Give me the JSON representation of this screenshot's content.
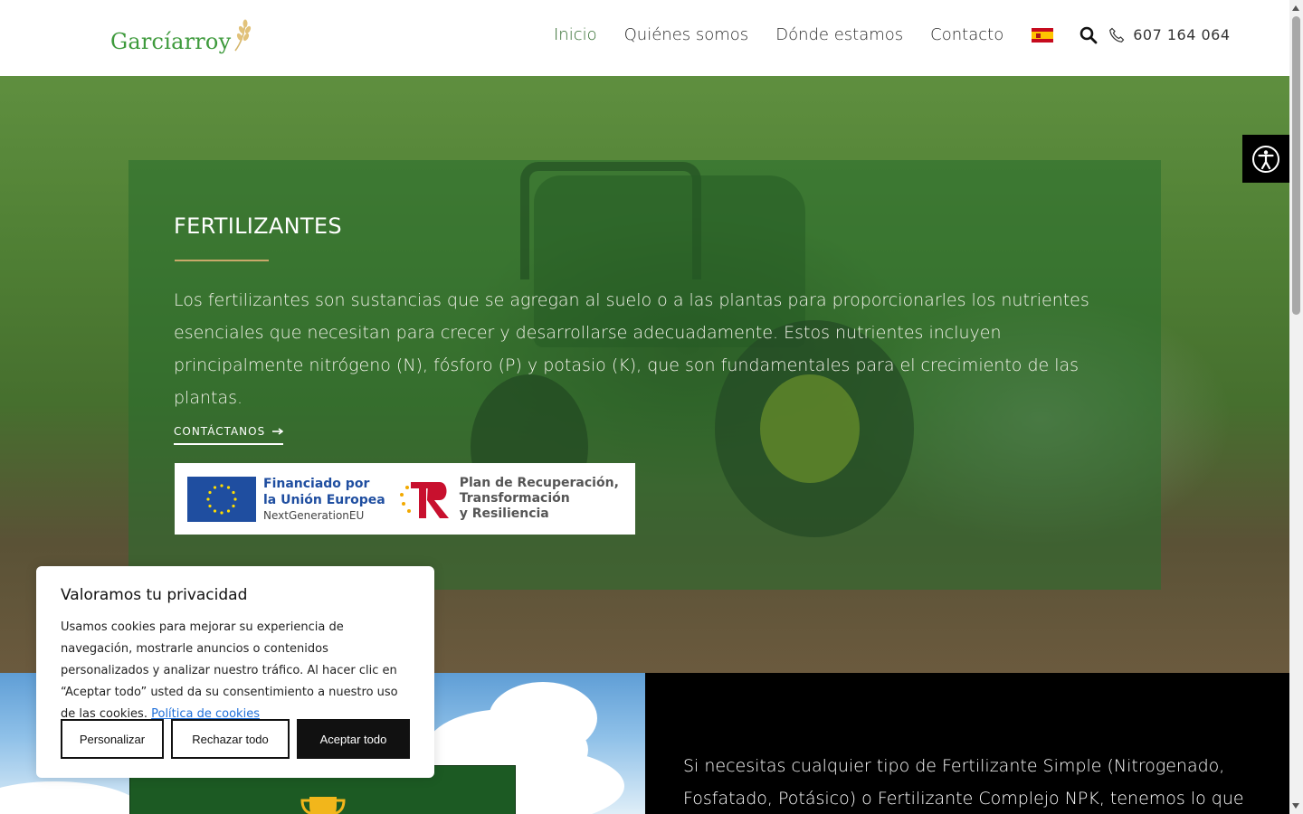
{
  "header": {
    "logo_text": "Garcíarroy",
    "nav": [
      {
        "label": "Inicio",
        "active": true
      },
      {
        "label": "Quiénes somos"
      },
      {
        "label": "Dónde estamos"
      },
      {
        "label": "Contacto"
      }
    ],
    "language_icon": "spain-flag-icon",
    "phone": "607 164 064"
  },
  "hero": {
    "title": "FERTILIZANTES",
    "text": "Los fertilizantes son sustancias que se agregan al suelo o a las plantas para proporcionarles los nutrientes esenciales que necesitan para crecer y desarrollarse adecuadamente. Estos nutrientes incluyen principalmente nitrógeno (N), fósforo (P) y potasio (K), que son fundamentales para el crecimiento de las plantas.",
    "cta": "CONTÁCTANOS",
    "eu_banner": {
      "line1": "Financiado por",
      "line2": "la Unión Europea",
      "line3": "NextGenerationEU",
      "prtr1": "Plan de Recuperación,",
      "prtr2": "Transformación",
      "prtr3": "y Resiliencia"
    }
  },
  "lower": {
    "text": "Si necesitas cualquier tipo de Fertilizante Simple (Nitrogenado, Fosfatado, Potásico) o Fertilizante Complejo NPK, tenemos lo que buscas."
  },
  "cookie": {
    "title": "Valoramos tu privacidad",
    "body": "Usamos cookies para mejorar su experiencia de navegación, mostrarle anuncios o contenidos personalizados y analizar nuestro tráfico. Al hacer clic en “Aceptar todo” usted da su consentimiento a nuestro uso de las cookies.",
    "link": "Política de cookies",
    "buttons": {
      "personalize": "Personalizar",
      "reject": "Rechazar todo",
      "accept": "Aceptar todo"
    }
  },
  "colors": {
    "brand_green": "#3e9a3c",
    "nav_active": "#2f6b2c",
    "accent_gold": "#c9a96a"
  }
}
